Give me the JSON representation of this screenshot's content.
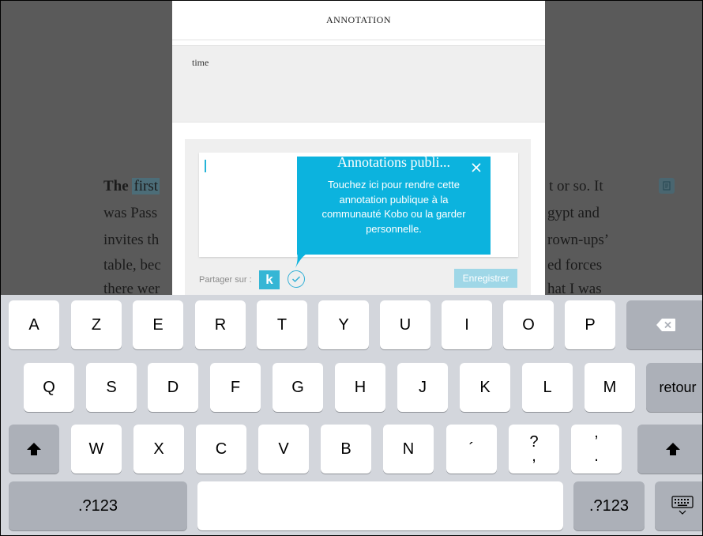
{
  "reader": {
    "lines": [
      {
        "left": "The",
        "hl": "first",
        "right": "t or so. It"
      },
      {
        "left": "was Pass",
        "hl": "",
        "right": "gypt and"
      },
      {
        "left": "invites th",
        "hl": "",
        "right": "rown-ups’"
      },
      {
        "left": "table, bec",
        "hl": "",
        "right": "ed forces"
      },
      {
        "left": "there wer",
        "hl": "",
        "right": "hat I was"
      }
    ],
    "note_icon": "note-icon"
  },
  "modal": {
    "title": "ANNOTATION",
    "quote": "time",
    "share_label": "Partager sur :",
    "kobo_label": "k",
    "save_label": "Enregistrer"
  },
  "tooltip": {
    "title": "Annotations publi...",
    "body": "Touchez ici pour rendre cette annotation publique à la communauté Kobo ou la garder personnelle."
  },
  "keyboard": {
    "row1": [
      "A",
      "Z",
      "E",
      "R",
      "T",
      "Y",
      "U",
      "I",
      "O",
      "P"
    ],
    "row2": [
      "Q",
      "S",
      "D",
      "F",
      "G",
      "H",
      "J",
      "K",
      "L",
      "M"
    ],
    "row3": [
      "W",
      "X",
      "C",
      "V",
      "B",
      "N"
    ],
    "apostrophe": "´",
    "question_top": "?",
    "question_bottom": ",",
    "period_top": "’",
    "period_bottom": ".",
    "return_label": "retour",
    "numbers_label": ".?123",
    "numbers_label_right": ".?123",
    "accent": "#0cb3de"
  }
}
